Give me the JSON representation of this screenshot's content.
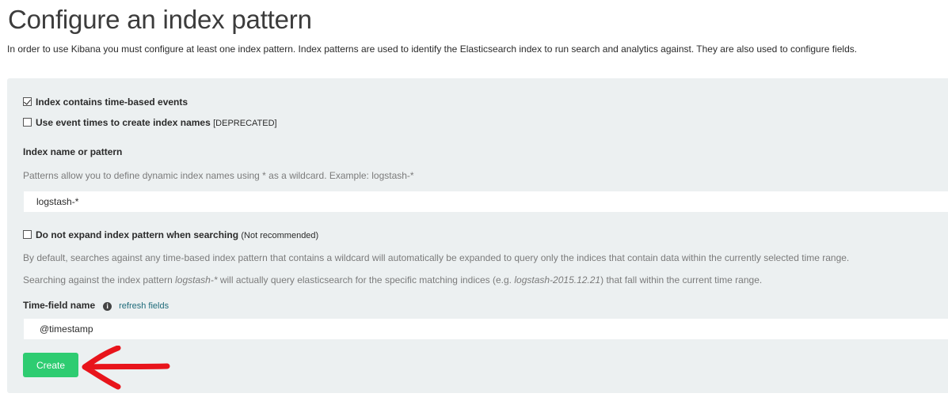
{
  "header": {
    "title": "Configure an index pattern",
    "intro": "In order to use Kibana you must configure at least one index pattern. Index patterns are used to identify the Elasticsearch index to run search and analytics against. They are also used to configure fields."
  },
  "form": {
    "time_based": {
      "label": "Index contains time-based events",
      "checked": true
    },
    "event_times": {
      "label": "Use event times to create index names",
      "tag": "[DEPRECATED]",
      "checked": false
    },
    "index_name": {
      "label": "Index name or pattern",
      "help": "Patterns allow you to define dynamic index names using * as a wildcard. Example: logstash-*",
      "value": "logstash-*"
    },
    "no_expand": {
      "label": "Do not expand index pattern when searching",
      "tag": "(Not recommended)",
      "checked": false,
      "help1": "By default, searches against any time-based index pattern that contains a wildcard will automatically be expanded to query only the indices that contain data within the currently selected time range.",
      "help2_a": "Searching against the index pattern ",
      "help2_pattern": "logstash-*",
      "help2_b": " will actually query elasticsearch for the specific matching indices (e.g. ",
      "help2_example": "logstash-2015.12.21",
      "help2_c": ") that fall within the current time range."
    },
    "time_field": {
      "label": "Time-field name",
      "info_icon": "info-circle-icon",
      "refresh_label": "refresh fields",
      "value": "@timestamp"
    },
    "create_label": "Create"
  },
  "annotation": {
    "arrow_color": "#e8141b",
    "arrow_icon": "left-arrow-icon"
  },
  "colors": {
    "panel": "#ecf0f1",
    "create_button": "#2ecc71",
    "link": "#1f6b7a"
  }
}
